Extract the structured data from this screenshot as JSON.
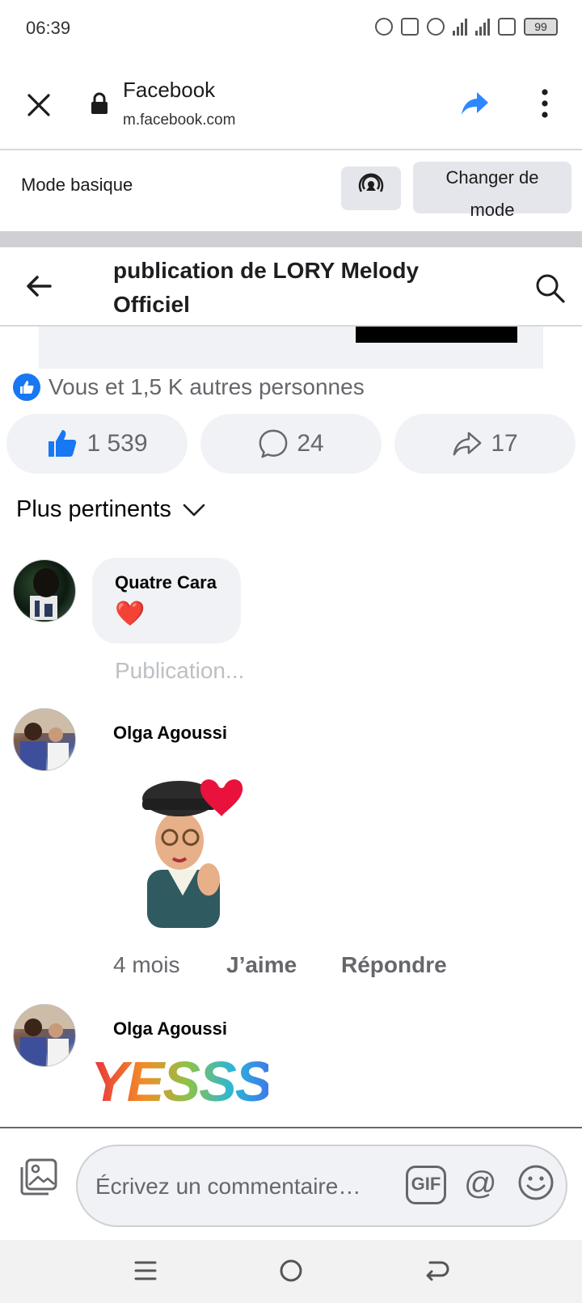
{
  "status_bar": {
    "time": "06:39",
    "battery": "99"
  },
  "browser": {
    "site_title": "Facebook",
    "site_url": "m.facebook.com"
  },
  "mode_bar": {
    "label": "Mode basique",
    "change_mode_label": "Changer de mode"
  },
  "page_header": {
    "title": "publication de LORY Melody Officiel"
  },
  "reactions": {
    "summary": "Vous et 1,5 K autres personnes",
    "like_count": "1 539",
    "comment_count": "24",
    "share_count": "17"
  },
  "sort": {
    "label": "Plus pertinents"
  },
  "comments": [
    {
      "author": "Quatre Cara",
      "content": "❤️",
      "meta": "Publication..."
    },
    {
      "author": "Olga Agoussi",
      "time": "4 mois",
      "like_label": "J’aime",
      "reply_label": "Répondre"
    },
    {
      "author": "Olga Agoussi",
      "sticker_text": "YESSS!"
    }
  ],
  "composer": {
    "placeholder": "Écrivez un commentaire…",
    "gif_label": "GIF",
    "at_label": "@"
  },
  "colors": {
    "brand_blue": "#1877f2",
    "share_blue": "#2d88ff",
    "heart_red": "#e41e3f",
    "secondary_text": "#65676b",
    "pill_bg": "#f0f2f5"
  }
}
